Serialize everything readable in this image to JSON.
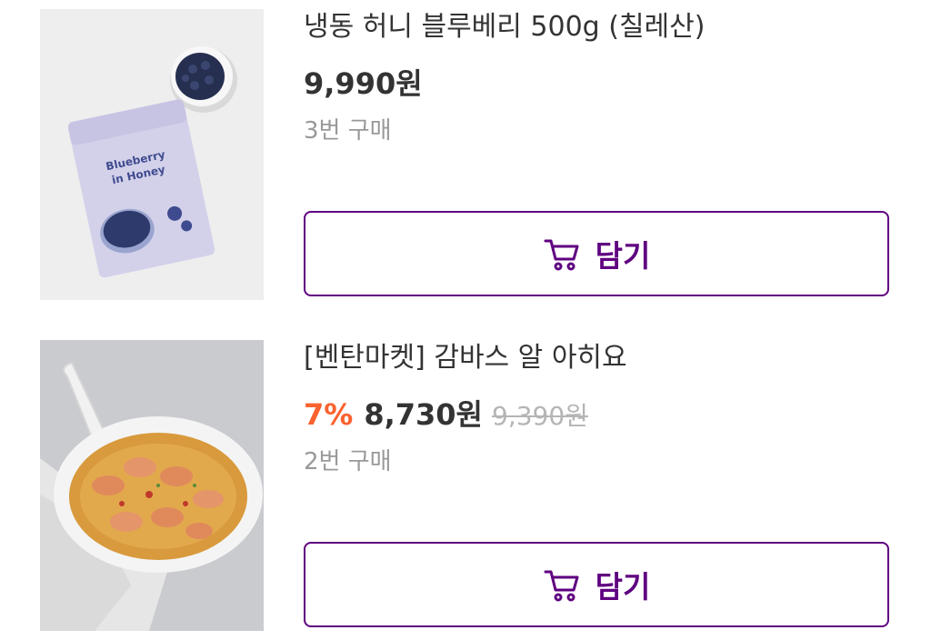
{
  "items": [
    {
      "name": "냉동 허니 블루베리 500g (칠레산)",
      "discount": "",
      "price": "9,990원",
      "original_price": "",
      "purchase_count": "3번 구매",
      "cart_label": "담기",
      "image_label": "Blueberry in Honey"
    },
    {
      "name": "[벤탄마켓] 감바스 알 아히요",
      "discount": "7%",
      "price": "8,730원",
      "original_price": "9,390원",
      "purchase_count": "2번 구매",
      "cart_label": "담기"
    }
  ],
  "colors": {
    "brand": "#5f0080",
    "discount": "#fa622f",
    "muted": "#999999",
    "strike": "#b5b5b5"
  },
  "icons": {
    "cart": "cart-icon"
  }
}
